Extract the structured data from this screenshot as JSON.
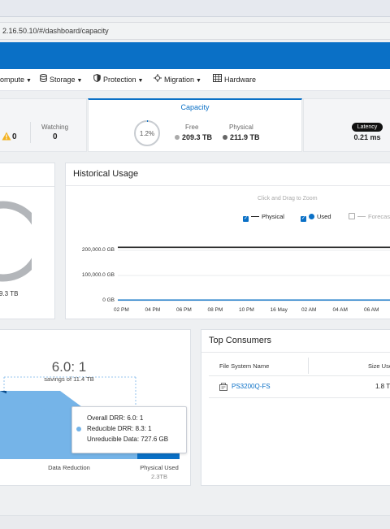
{
  "browser": {
    "url": "2.16.50.10/#/dashboard/capacity"
  },
  "menu": {
    "items": [
      {
        "label": "ompute",
        "icon": "compute-icon"
      },
      {
        "label": "Storage",
        "icon": "database-icon"
      },
      {
        "label": "Protection",
        "icon": "shield-icon"
      },
      {
        "label": "Migration",
        "icon": "migration-icon"
      },
      {
        "label": "Hardware",
        "icon": "hardware-icon"
      }
    ]
  },
  "tiles": {
    "alerts": {
      "warning_count": "0",
      "watching_label": "Watching",
      "watching_value": "0"
    },
    "capacity": {
      "title": "Capacity",
      "ring_percent": "1.2%",
      "free_label": "Free",
      "free_value": "209.3 TB",
      "physical_label": "Physical",
      "physical_value": "211.9 TB"
    },
    "latency": {
      "badge": "Latency",
      "value": "0.21 ms"
    }
  },
  "left_panel": {
    "partial_value": "9.3 TB"
  },
  "historical": {
    "title": "Historical Usage",
    "hint": "Click and Drag to Zoom",
    "legend": [
      {
        "label": "Physical",
        "checked": true
      },
      {
        "label": "Used",
        "checked": true
      },
      {
        "label": "Forecast",
        "checked": false
      }
    ]
  },
  "chart_data": {
    "type": "line",
    "title": "Historical Usage",
    "x": [
      "02 PM",
      "04 PM",
      "06 PM",
      "08 PM",
      "10 PM",
      "16 May",
      "02 AM",
      "04 AM",
      "06 AM"
    ],
    "y_ticks": [
      "0 GB",
      "100,000.0 GB",
      "200,000.0 GB"
    ],
    "ylim": [
      0,
      240000
    ],
    "series": [
      {
        "name": "Physical",
        "values": [
          211900,
          211900,
          211900,
          211900,
          211900,
          211900,
          211900,
          211900,
          211900
        ],
        "color": "#222222"
      },
      {
        "name": "Used",
        "values": [
          2600,
          2500,
          2500,
          2500,
          2500,
          2500,
          2500,
          2500,
          2500
        ],
        "color": "#0a70c6"
      }
    ]
  },
  "data_reduction": {
    "ratio": "6.0: 1",
    "savings": "savings of 11.4 TB",
    "x_label": "Data Reduction",
    "physical_used_label": "Physical Used",
    "physical_used_value": "2.3TB",
    "tooltip": {
      "overall": "Overall DRR: 6.0: 1",
      "reducible": "Reducible DRR: 8.3: 1",
      "unreducible": "Unreducible Data: 727.6 GB"
    }
  },
  "top_consumers": {
    "title": "Top Consumers",
    "col_name": "File System Name",
    "col_size": "Size Use",
    "rows": [
      {
        "name": "PS3200Q-FS",
        "size": "1.8 T"
      }
    ]
  },
  "colors": {
    "brand": "#0a70c6",
    "warning": "#f2b120"
  }
}
